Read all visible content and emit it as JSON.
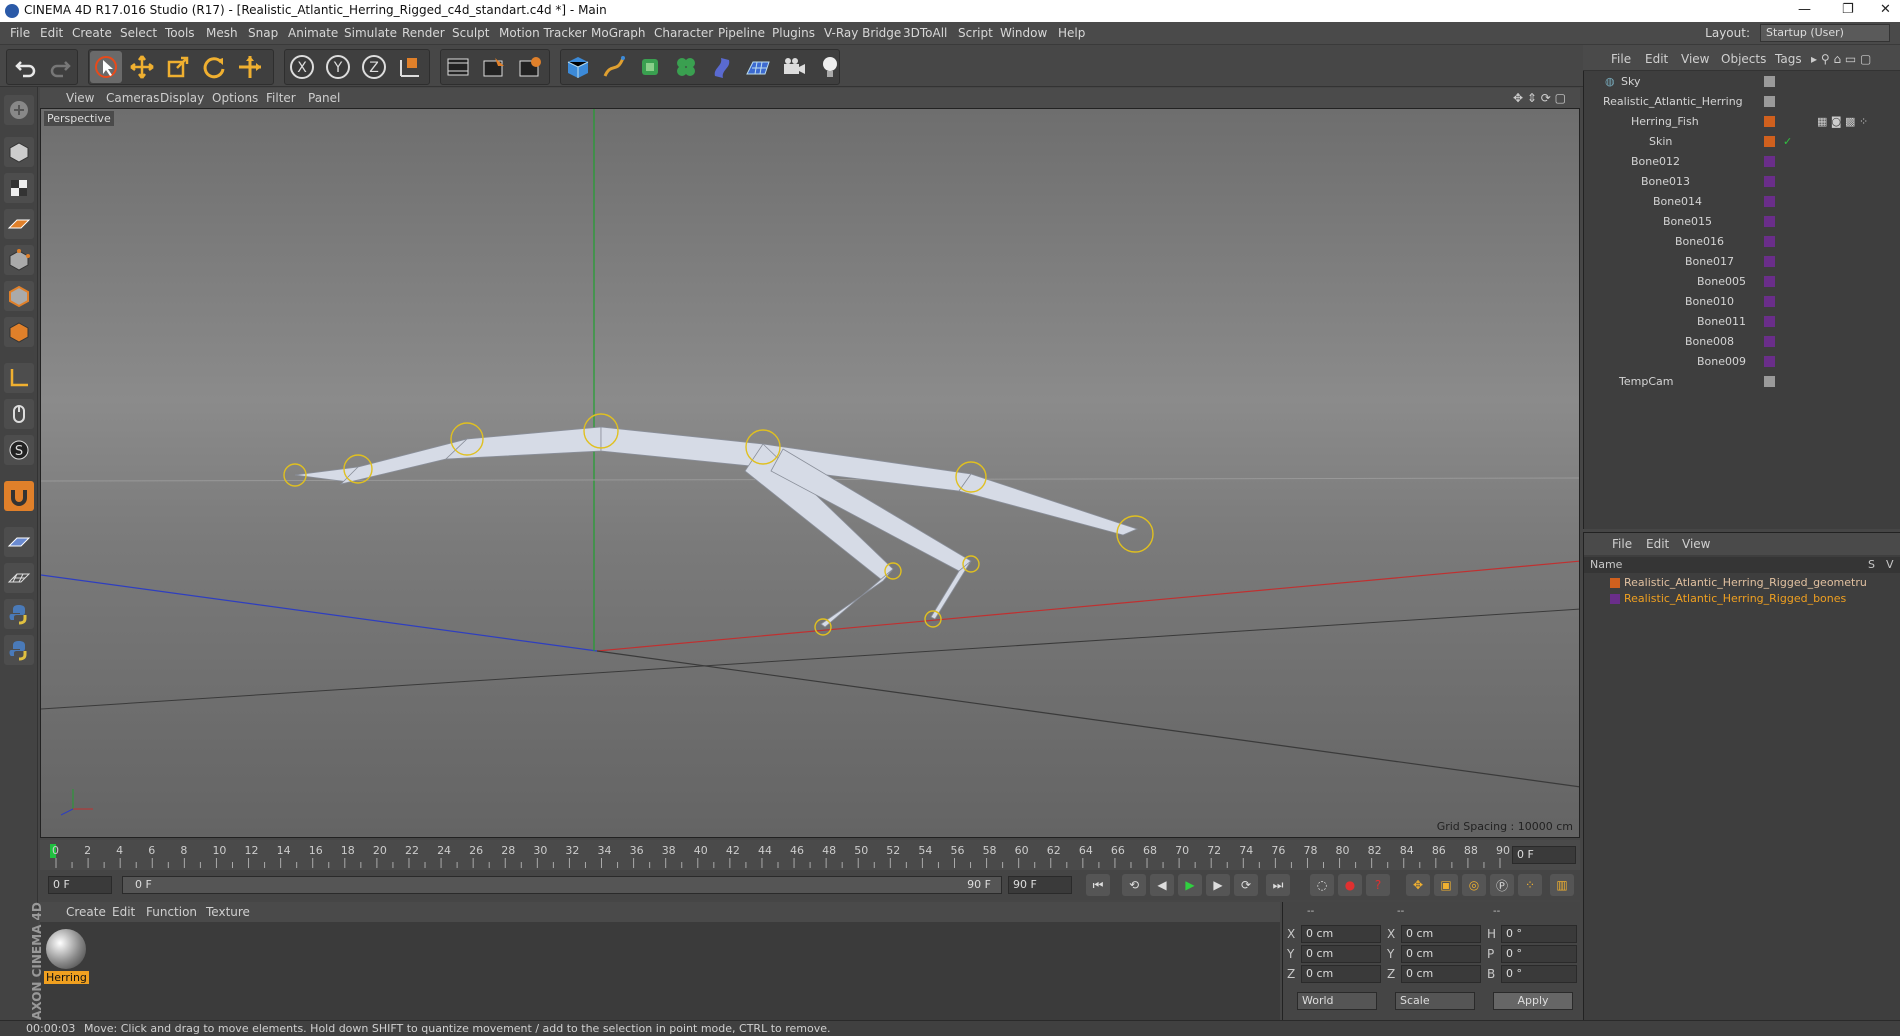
{
  "window": {
    "title": "CINEMA 4D R17.016 Studio (R17) - [Realistic_Atlantic_Herring_Rigged_c4d_standart.c4d *] - Main",
    "minimize": "—",
    "maximize": "❐",
    "close": "✕"
  },
  "menubar": {
    "items": [
      "File",
      "Edit",
      "Create",
      "Select",
      "Tools",
      "Mesh",
      "Snap",
      "Animate",
      "Simulate",
      "Render",
      "Sculpt",
      "Motion Tracker",
      "MoGraph",
      "Character",
      "Pipeline",
      "Plugins",
      "V-Ray Bridge",
      "3DToAll",
      "Script",
      "Window",
      "Help"
    ],
    "layout_label": "Layout:",
    "layout_value": "Startup (User)"
  },
  "toolbar": {
    "icons": [
      "undo-icon",
      "redo-icon",
      "live-selection-icon",
      "move-icon",
      "scale-icon",
      "rotate-icon",
      "move-axis-icon",
      "x-axis-icon",
      "y-axis-icon",
      "z-axis-icon",
      "coordinate-system-icon",
      "render-view-icon",
      "render-picture-viewer-icon",
      "edit-render-settings-icon",
      "cube-icon",
      "pen-icon",
      "subdivision-icon",
      "cloner-icon",
      "deformer-icon",
      "floor-icon",
      "camera-icon",
      "light-icon"
    ]
  },
  "viewport": {
    "menu": [
      "View",
      "Cameras",
      "Display",
      "Options",
      "Filter",
      "Panel"
    ],
    "label": "Perspective",
    "grid_spacing": "Grid Spacing : 10000 cm"
  },
  "timeline": {
    "ticks": [
      "0",
      "2",
      "4",
      "6",
      "8",
      "10",
      "12",
      "14",
      "16",
      "18",
      "20",
      "22",
      "24",
      "26",
      "28",
      "30",
      "32",
      "34",
      "36",
      "38",
      "40",
      "42",
      "44",
      "46",
      "48",
      "50",
      "52",
      "54",
      "56",
      "58",
      "60",
      "62",
      "64",
      "66",
      "68",
      "70",
      "72",
      "74",
      "76",
      "78",
      "80",
      "82",
      "84",
      "86",
      "88",
      "90"
    ],
    "current_frame_field": "0 F"
  },
  "playbar": {
    "start_field": "0 F",
    "range_start": "0 F",
    "range_end": "90 F",
    "end_field": "90 F"
  },
  "material_manager": {
    "menu": [
      "Create",
      "Edit",
      "Function",
      "Texture"
    ],
    "material_name": "Herring",
    "brand": "MAXON CINEMA 4D"
  },
  "coordinates": {
    "header": [
      "--",
      "--",
      "--"
    ],
    "rows": [
      {
        "a": "X",
        "av": "0 cm",
        "b": "X",
        "bv": "0 cm",
        "c": "H",
        "cv": "0 °"
      },
      {
        "a": "Y",
        "av": "0 cm",
        "b": "Y",
        "bv": "0 cm",
        "c": "P",
        "cv": "0 °"
      },
      {
        "a": "Z",
        "av": "0 cm",
        "b": "Z",
        "bv": "0 cm",
        "c": "B",
        "cv": "0 °"
      }
    ],
    "mode": "World",
    "scale": "Scale",
    "apply": "Apply"
  },
  "object_manager": {
    "menu": [
      "File",
      "Edit",
      "View",
      "Objects",
      "Tags"
    ],
    "objects": [
      {
        "name": "Sky",
        "color": "#9a9a9a"
      },
      {
        "name": "Realistic_Atlantic_Herring",
        "color": "#9a9a9a"
      },
      {
        "name": "Herring_Fish",
        "color": "#d0601e"
      },
      {
        "name": "Skin",
        "color": "#d0601e"
      },
      {
        "name": "Bone012",
        "color": "#6a2e8a"
      },
      {
        "name": "Bone013",
        "color": "#6a2e8a"
      },
      {
        "name": "Bone014",
        "color": "#6a2e8a"
      },
      {
        "name": "Bone015",
        "color": "#6a2e8a"
      },
      {
        "name": "Bone016",
        "color": "#6a2e8a"
      },
      {
        "name": "Bone017",
        "color": "#6a2e8a"
      },
      {
        "name": "Bone005",
        "color": "#6a2e8a"
      },
      {
        "name": "Bone010",
        "color": "#6a2e8a"
      },
      {
        "name": "Bone011",
        "color": "#6a2e8a"
      },
      {
        "name": "Bone008",
        "color": "#6a2e8a"
      },
      {
        "name": "Bone009",
        "color": "#6a2e8a"
      },
      {
        "name": "TempCam",
        "color": "#9a9a9a"
      }
    ]
  },
  "layer_manager": {
    "menu": [
      "File",
      "Edit",
      "View"
    ],
    "headers": {
      "name": "Name",
      "s": "S",
      "v": "V"
    },
    "layers": [
      {
        "name": "Realistic_Atlantic_Herring_Rigged_geometru",
        "color": "#d0601e"
      },
      {
        "name": "Realistic_Atlantic_Herring_Rigged_bones",
        "color": "#6a2e8a"
      }
    ]
  },
  "status": {
    "time": "00:00:03",
    "message": "Move: Click and drag to move elements. Hold down SHIFT to quantize movement / add to the selection in point mode, CTRL to remove."
  }
}
